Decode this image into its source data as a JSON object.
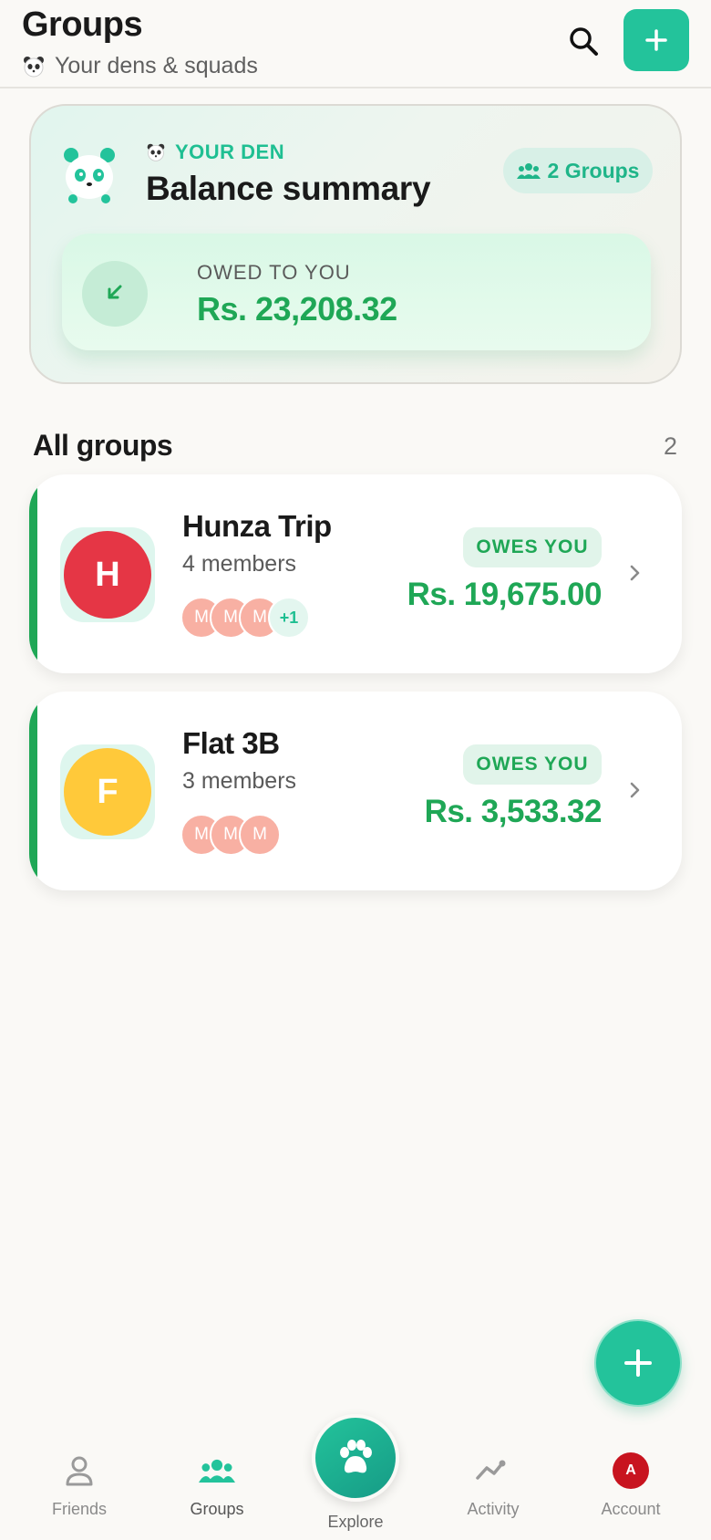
{
  "header": {
    "title": "Groups",
    "subtitle": "Your dens & squads",
    "search_icon": "search-icon",
    "add_icon": "plus-icon"
  },
  "summary": {
    "den_label": "YOUR DEN",
    "title": "Balance summary",
    "groups_pill": "2 Groups",
    "owed_label": "OWED TO YOU",
    "owed_amount": "Rs. 23,208.32"
  },
  "all_groups": {
    "title": "All groups",
    "count": "2"
  },
  "groups": [
    {
      "initial": "H",
      "name": "Hunza Trip",
      "members": "4 members",
      "avatar_color": "#e53645",
      "mini_avatars": [
        "M",
        "M",
        "M"
      ],
      "more": "+1",
      "status": "OWES YOU",
      "amount": "Rs. 19,675.00"
    },
    {
      "initial": "F",
      "name": "Flat 3B",
      "members": "3 members",
      "avatar_color": "#ffc93a",
      "mini_avatars": [
        "M",
        "M",
        "M"
      ],
      "status": "OWES YOU",
      "amount": "Rs. 3,533.32"
    }
  ],
  "nav": {
    "friends": "Friends",
    "groups": "Groups",
    "explore": "Explore",
    "activity": "Activity",
    "account": "Account",
    "account_initial": "A"
  },
  "colors": {
    "accent": "#23c39b",
    "positive": "#1fa756",
    "background": "#faf9f6"
  }
}
